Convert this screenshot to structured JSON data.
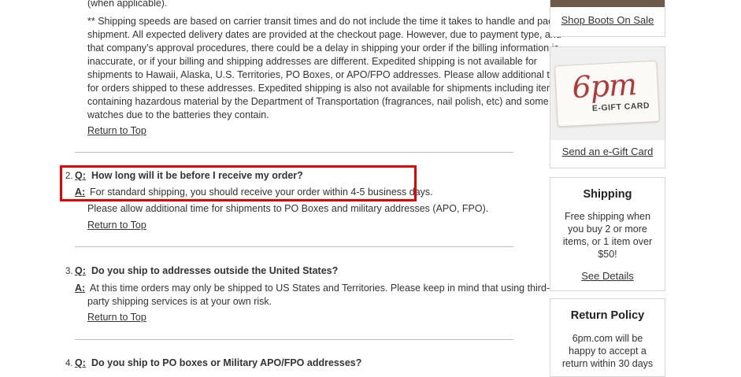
{
  "faq": {
    "intro_tail": "(when applicable).",
    "shipping_note_lines": [
      "** Shipping speeds are based on carrier transit times and do not include the time it takes to handle and pack a",
      "shipment. All expected delivery dates are provided at the checkout page. However, due to payment type, and",
      "that company’s approval procedures, there could be a delay in shipping your order if the billing information is",
      "inaccurate, or if your billing and shipping addresses are different. Expedited shipping is not available for",
      "shipments to Hawaii, Alaska, U.S. Territories, PO Boxes, or APO/FPO addresses. Please allow additional time",
      "for orders shipped to these addresses. Expedited shipping is also not available for shipments including items",
      "containing hazardous material by the Department of Transportation (fragrances, nail polish, etc) and some",
      "watches due to the batteries they contain."
    ],
    "return_to_top": "Return to Top",
    "q_marker": "Q:",
    "a_marker": "A:",
    "items": [
      {
        "number": "2.",
        "question": "How long will it be before I receive my order?",
        "answer_lines": [
          "For standard shipping, you should receive your order within 4-5 business days.",
          "Please allow additional time for shipments to PO Boxes and military addresses (APO, FPO)."
        ]
      },
      {
        "number": "3.",
        "question": "Do you ship to addresses outside the United States?",
        "answer_lines": [
          "At this time orders may only be shipped to US States and Territories. Please keep in mind that using third-",
          "party shipping services is at your own risk."
        ]
      },
      {
        "number": "4.",
        "question": "Do you ship to PO boxes or Military APO/FPO addresses?"
      }
    ]
  },
  "sidebar": {
    "boots_link": "Shop Boots On Sale",
    "gift_logo": "6pm",
    "gift_label": "E-GIFT CARD",
    "gift_link": "Send an e-Gift Card",
    "shipping": {
      "title": "Shipping",
      "lines": [
        "Free shipping when",
        "you buy 2 or more",
        "items, or 1 item over",
        "$50!"
      ],
      "link": "See Details"
    },
    "returns": {
      "title": "Return Policy",
      "lines": [
        "6pm.com will be",
        "happy to accept a",
        "return within 30 days"
      ]
    }
  },
  "colors": {
    "highlight": "#e60000",
    "gift_logo": "#b03a3a"
  }
}
